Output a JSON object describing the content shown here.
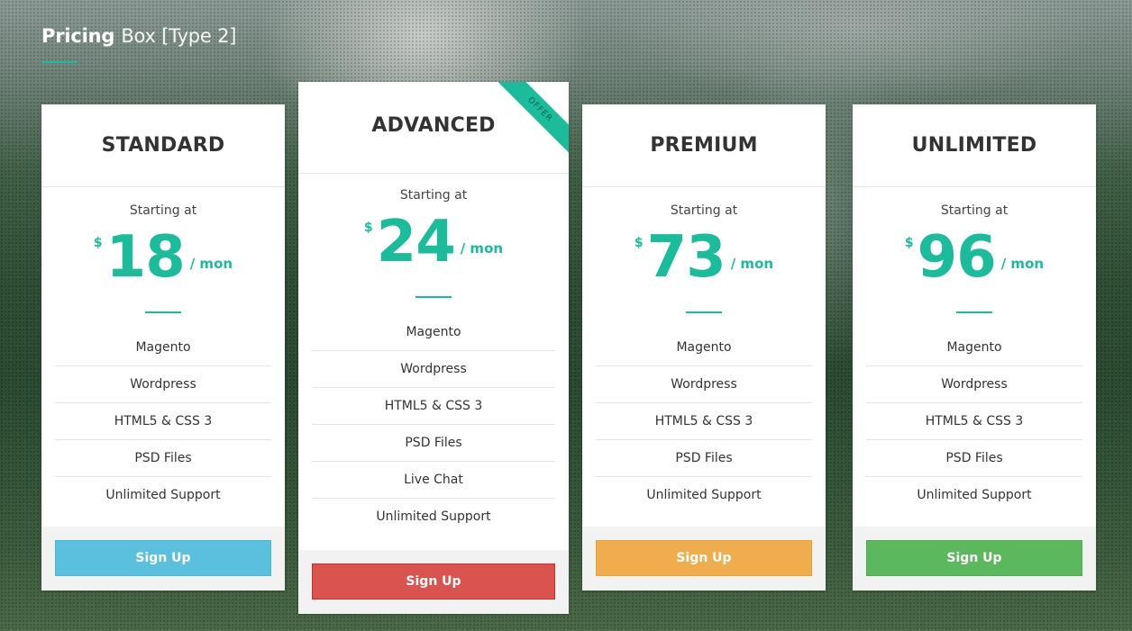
{
  "header": {
    "title_strong": "Pricing",
    "title_light": "Box [Type 2]"
  },
  "colors": {
    "accent": "#1abc9c",
    "blue": "#5bc0de",
    "red": "#d9534f",
    "orange": "#f0ad4e",
    "green": "#5cb85c"
  },
  "plans": [
    {
      "name": "STANDARD",
      "starting": "Starting at",
      "currency": "$",
      "amount": "18",
      "period": "/ mon",
      "features": [
        "Magento",
        "Wordpress",
        "HTML5 & CSS 3",
        "PSD Files",
        "Unlimited Support"
      ],
      "button": "Sign Up"
    },
    {
      "name": "ADVANCED",
      "ribbon": "OFFER",
      "starting": "Starting at",
      "currency": "$",
      "amount": "24",
      "period": "/ mon",
      "features": [
        "Magento",
        "Wordpress",
        "HTML5 & CSS 3",
        "PSD Files",
        "Live Chat",
        "Unlimited Support"
      ],
      "button": "Sign Up"
    },
    {
      "name": "PREMIUM",
      "starting": "Starting at",
      "currency": "$",
      "amount": "73",
      "period": "/ mon",
      "features": [
        "Magento",
        "Wordpress",
        "HTML5 & CSS 3",
        "PSD Files",
        "Unlimited Support"
      ],
      "button": "Sign Up"
    },
    {
      "name": "UNLIMITED",
      "starting": "Starting at",
      "currency": "$",
      "amount": "96",
      "period": "/ mon",
      "features": [
        "Magento",
        "Wordpress",
        "HTML5 & CSS 3",
        "PSD Files",
        "Unlimited Support"
      ],
      "button": "Sign Up"
    }
  ]
}
